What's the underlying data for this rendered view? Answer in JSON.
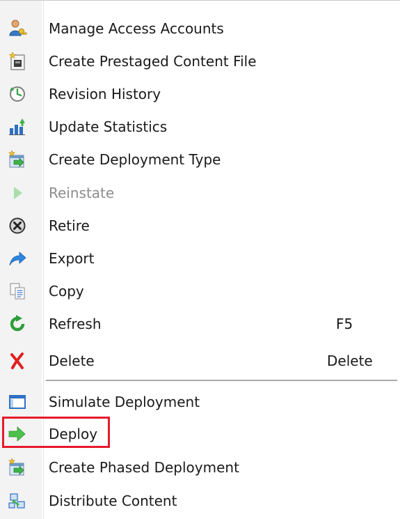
{
  "menu": {
    "items": [
      {
        "label": "Manage Access Accounts",
        "icon": "manage-access-accounts-icon"
      },
      {
        "label": "Create Prestaged Content File",
        "icon": "prestaged-content-icon"
      },
      {
        "label": "Revision History",
        "icon": "revision-history-icon"
      },
      {
        "label": "Update Statistics",
        "icon": "update-statistics-icon"
      },
      {
        "label": "Create Deployment Type",
        "icon": "create-deployment-type-icon"
      },
      {
        "label": "Reinstate",
        "icon": "reinstate-icon",
        "disabled": true
      },
      {
        "label": "Retire",
        "icon": "retire-icon"
      },
      {
        "label": "Export",
        "icon": "export-icon"
      },
      {
        "label": "Copy",
        "icon": "copy-icon"
      },
      {
        "label": "Refresh",
        "icon": "refresh-icon",
        "shortcut": "F5"
      },
      {
        "label": "Delete",
        "icon": "delete-icon",
        "shortcut": "Delete"
      },
      {
        "label": "Simulate Deployment",
        "icon": "simulate-deployment-icon"
      },
      {
        "label": "Deploy",
        "icon": "deploy-icon",
        "highlighted": true
      },
      {
        "label": "Create Phased Deployment",
        "icon": "phased-deployment-icon"
      },
      {
        "label": "Distribute Content",
        "icon": "distribute-content-icon"
      }
    ]
  },
  "colors": {
    "highlight_border": "#e8192c",
    "disabled_text": "#8c8c8c",
    "text": "#1a1a1a"
  }
}
